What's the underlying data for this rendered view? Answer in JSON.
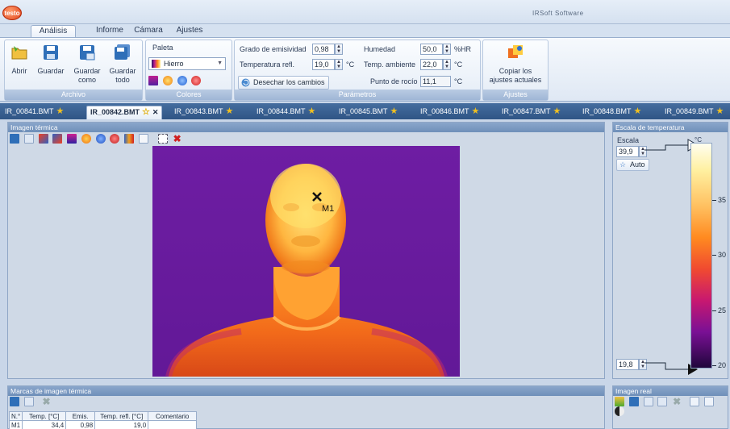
{
  "app": {
    "logo": "testo",
    "window_title": "IRSoft Software"
  },
  "ribbon_tabs": [
    "Análisis",
    "Informe",
    "Cámara",
    "Ajustes"
  ],
  "archivo": {
    "title": "Archivo",
    "open": "Abrir",
    "save": "Guardar",
    "save_as": "Guardar como",
    "save_all": "Guardar todo"
  },
  "colores": {
    "title": "Colores",
    "palette_label": "Paleta",
    "palette_value": "Hierro"
  },
  "parametros": {
    "title": "Parámetros",
    "emissivity_label": "Grado de emisividad",
    "emissivity_value": "0,98",
    "refl_temp_label": "Temperatura refl.",
    "refl_temp_value": "19,0",
    "refl_temp_unit": "°C",
    "humidity_label": "Humedad",
    "humidity_value": "50,0",
    "humidity_unit": "%HR",
    "ambient_label": "Temp. ambiente",
    "ambient_value": "22,0",
    "ambient_unit": "°C",
    "dewpoint_label": "Punto de rocío",
    "dewpoint_value": "11,1",
    "dewpoint_unit": "°C",
    "discard_label": "Desechar los cambios"
  },
  "ajustes": {
    "title": "Ajustes",
    "copy_label_1": "Copiar los",
    "copy_label_2": "ajustes actuales"
  },
  "file_tabs": [
    "IR_00841.BMT",
    "IR_00842.BMT",
    "IR_00843.BMT",
    "IR_00844.BMT",
    "IR_00845.BMT",
    "IR_00846.BMT",
    "IR_00847.BMT",
    "IR_00848.BMT",
    "IR_00849.BMT"
  ],
  "active_file_tab": "IR_00842.BMT",
  "thermal_panel": {
    "title": "Imagen térmica",
    "marker_label": "M1"
  },
  "scale_panel": {
    "title": "Escala de temperatura",
    "scale_label": "Escala",
    "max_value": "39,9",
    "min_value": "19,8",
    "auto_label": "Auto",
    "unit": "°C",
    "ticks": [
      "35",
      "30",
      "25",
      "20"
    ]
  },
  "marks_panel": {
    "title": "Marcas de imagen térmica",
    "headers": [
      "N.°",
      "Temp. [°C]",
      "Emis.",
      "Temp. refl. [°C]",
      "Comentario"
    ],
    "row": {
      "id": "M1",
      "temp": "34,4",
      "emis": "0,98",
      "refl": "19,0",
      "comment": ""
    }
  },
  "real_panel": {
    "title": "Imagen real"
  },
  "colors": {
    "ribbon_blue": "#6f8fb9",
    "tab_strip": "#2f5585",
    "accent_orange": "#ff8a20"
  }
}
